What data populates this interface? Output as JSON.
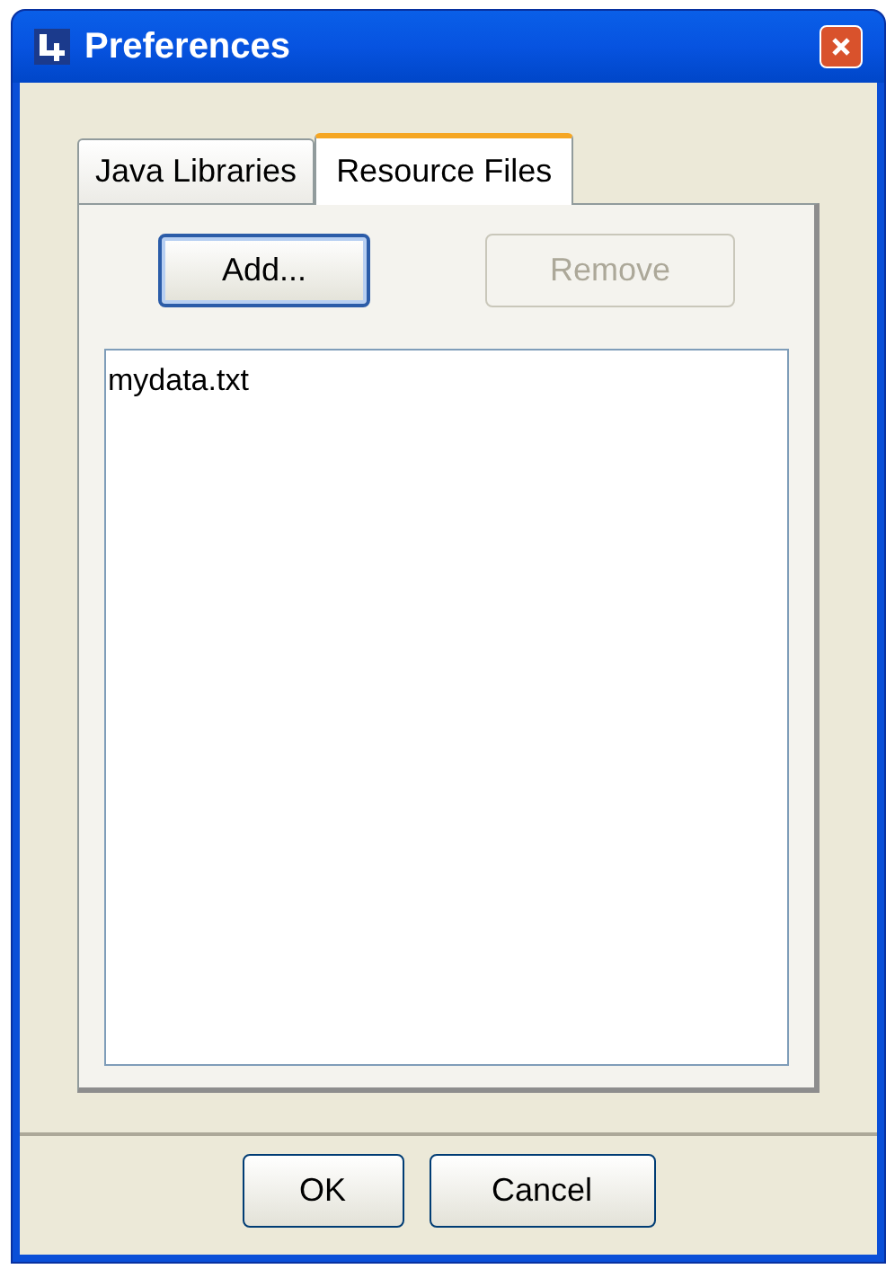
{
  "window": {
    "title": "Preferences"
  },
  "tabs": [
    {
      "label": "Java Libraries",
      "selected": false
    },
    {
      "label": "Resource Files",
      "selected": true
    }
  ],
  "toolbar_buttons": [
    {
      "label": "Add...",
      "disabled": false,
      "focused": true
    },
    {
      "label": "Remove",
      "disabled": true,
      "focused": false
    }
  ],
  "files": [
    "mydata.txt"
  ],
  "buttons": [
    "OK",
    "Cancel"
  ]
}
